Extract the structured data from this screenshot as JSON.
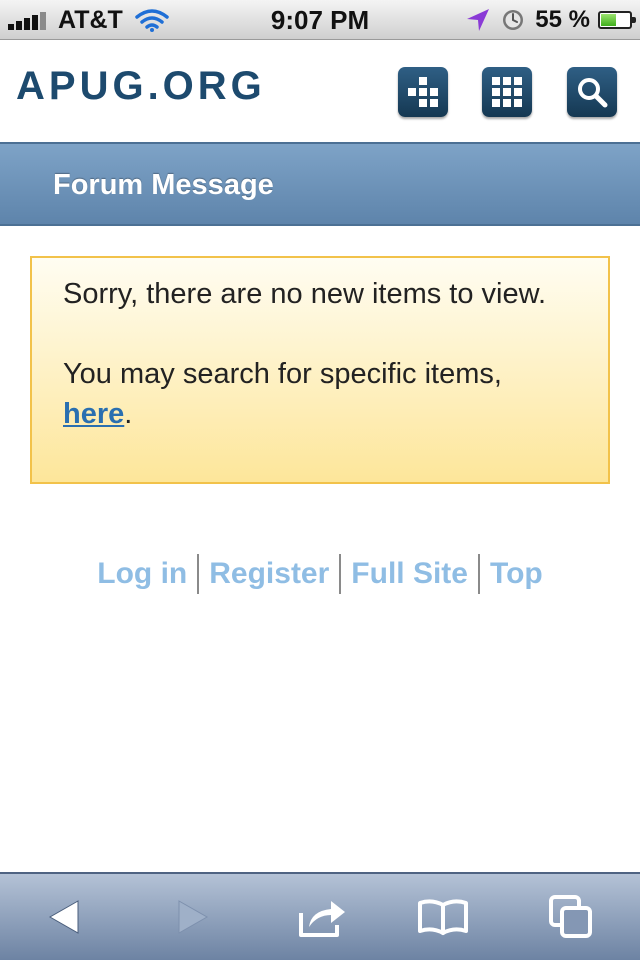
{
  "status_bar": {
    "carrier": "AT&T",
    "time": "9:07 PM",
    "battery_percent": "55 %",
    "battery_level": 0.55,
    "signal_bars": 4,
    "icons": [
      "signal-icon",
      "wifi-icon",
      "location-arrow-icon",
      "alarm-icon",
      "battery-icon"
    ]
  },
  "header": {
    "logo": "APUG.ORG",
    "buttons": [
      {
        "name": "menu-button",
        "icon": "cross-blocks-icon"
      },
      {
        "name": "grid-button",
        "icon": "grid-icon"
      },
      {
        "name": "search-button",
        "icon": "search-icon"
      }
    ]
  },
  "page": {
    "title": "Forum Message"
  },
  "message": {
    "line1": "Sorry, there are no new items to view.",
    "line2_prefix": "You may search for specific items, ",
    "link": "here",
    "line2_suffix": "."
  },
  "footer": {
    "links": [
      "Log in",
      "Register",
      "Full Site",
      "Top"
    ]
  },
  "toolbar": {
    "buttons": [
      "back-icon",
      "forward-icon",
      "share-icon",
      "bookmarks-icon",
      "pages-icon"
    ]
  },
  "colors": {
    "brand": "#1d4a6e",
    "title_band": "#6f95bb",
    "message_border": "#f2c24a",
    "message_bg": "#fdeeb5",
    "link": "#2a6fb0",
    "footer_link": "#8fbde4"
  }
}
